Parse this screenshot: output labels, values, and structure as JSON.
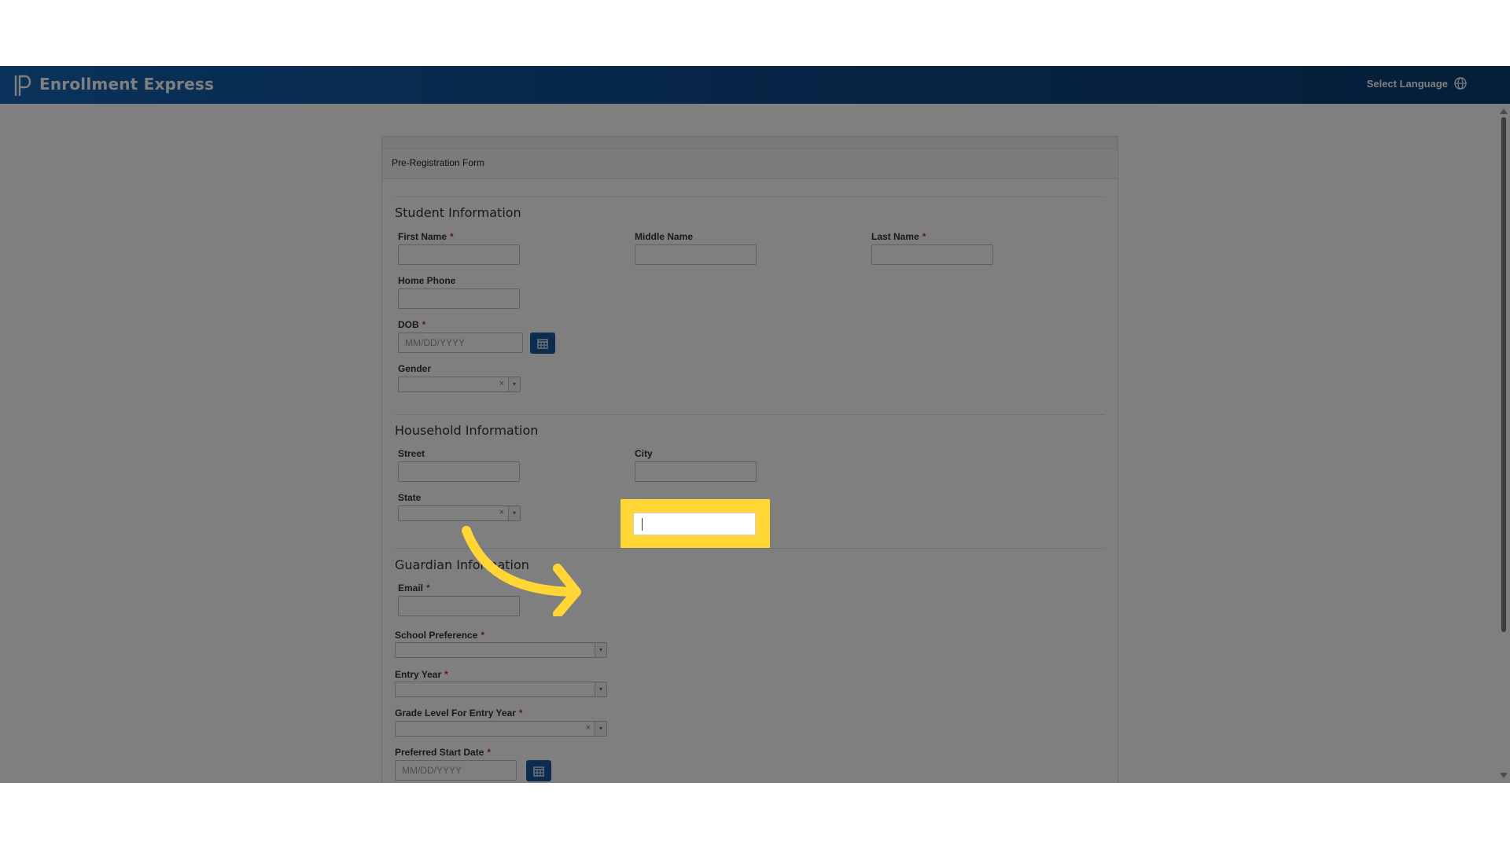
{
  "header": {
    "app_title": "Enrollment Express",
    "language_label": "Select Language"
  },
  "form": {
    "title": "Pre-Registration Form",
    "student_section": {
      "title": "Student Information",
      "first_name_label": "First Name",
      "middle_name_label": "Middle Name",
      "last_name_label": "Last Name",
      "home_phone_label": "Home Phone",
      "dob_label": "DOB",
      "dob_placeholder": "MM/DD/YYYY",
      "gender_label": "Gender"
    },
    "household_section": {
      "title": "Household Information",
      "street_label": "Street",
      "city_label": "City",
      "state_label": "State"
    },
    "guardian_section": {
      "title": "Guardian Information",
      "email_label": "Email",
      "school_preference_label": "School Preference",
      "entry_year_label": "Entry Year",
      "grade_level_label": "Grade Level For Entry Year",
      "preferred_start_label": "Preferred Start Date",
      "preferred_start_placeholder": "MM/DD/YYYY"
    },
    "required_marker": "*",
    "clear_glyph": "×",
    "dropdown_glyph": "▾"
  },
  "colors": {
    "header_start": "#1565b5",
    "header_end": "#0b3c72",
    "highlight": "#ffd634",
    "required": "#c0392b",
    "calendar_button": "#1a5aa0"
  },
  "icons": [
    "logo-icon",
    "globe-icon",
    "calendar-icon",
    "arrow-annotation-icon"
  ]
}
